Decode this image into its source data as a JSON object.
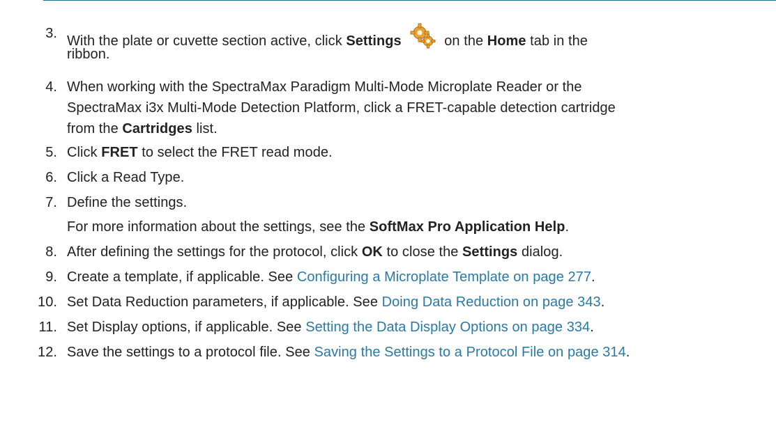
{
  "doc": {
    "steps": [
      {
        "number": "3.",
        "lead": "With the plate or cuvette section active, click ",
        "bold1": "Settings",
        "icon": "settings-gears-icon",
        "mid": " on the ",
        "bold2": "Home",
        "tail": " tab in the",
        "line2": "ribbon."
      },
      {
        "number": "4.",
        "line1": "When working with the SpectraMax Paradigm Multi-Mode Microplate Reader or the",
        "line2": "SpectraMax i3x Multi-Mode Detection Platform, click a FRET-capable detection cartridge",
        "line3a": "from the ",
        "bold": "Cartridges",
        "line3b": " list."
      },
      {
        "number": "5.",
        "pre": "Click ",
        "bold": "FRET",
        "post": " to select the FRET read mode."
      },
      {
        "number": "6.",
        "text": "Click a Read Type."
      },
      {
        "number": "7.",
        "text": "Define the settings.",
        "note_pre": "For more information about the settings, see the ",
        "note_bold": "SoftMax Pro Application Help",
        "note_post": "."
      },
      {
        "number": "8.",
        "pre": "After defining the settings for the protocol, click ",
        "bold1": "OK",
        "mid": " to close the ",
        "bold2": "Settings",
        "post": " dialog."
      },
      {
        "number": "9.",
        "pre": "Create a template, if applicable. See ",
        "link": "Configuring a Microplate Template on page 277",
        "post": "."
      },
      {
        "number": "10.",
        "pre": "Set Data Reduction parameters, if applicable. See ",
        "link": "Doing Data Reduction on page 343",
        "post": "."
      },
      {
        "number": "11.",
        "pre": "Set Display options, if applicable. See ",
        "link": "Setting the Data Display Options on page 334",
        "post": "."
      },
      {
        "number": "12.",
        "pre": "Save the settings to a protocol file. See ",
        "link": "Saving the Settings to a Protocol File on page 314",
        "post": "."
      }
    ]
  },
  "colors": {
    "link": "#2a7aa5",
    "rule": "#1f6f8b",
    "text": "#222222",
    "gear": "#e8a33a"
  }
}
